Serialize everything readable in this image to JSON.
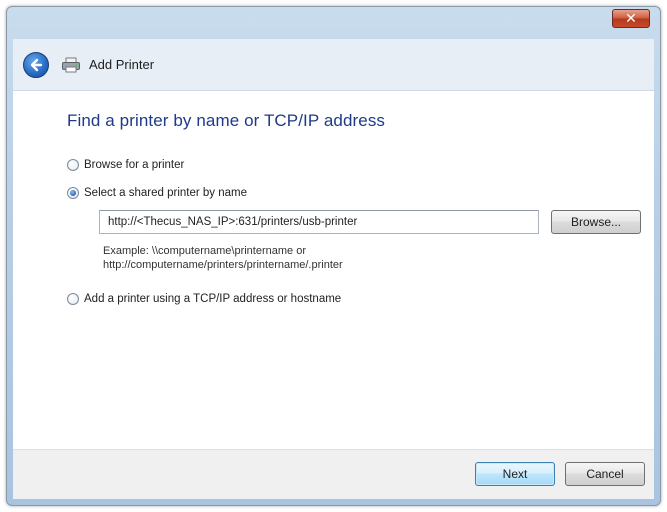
{
  "window": {
    "close_icon": "close-icon",
    "close_glyph": "✕"
  },
  "header": {
    "back_icon": "back-arrow-icon",
    "printer_icon": "printer-icon",
    "title": "Add Printer"
  },
  "main": {
    "heading": "Find a printer by name or TCP/IP address",
    "options": [
      {
        "label": "Browse for a printer",
        "checked": false
      },
      {
        "label": "Select a shared printer by name",
        "checked": true
      },
      {
        "label": "Add a printer using a TCP/IP address or hostname",
        "checked": false
      }
    ],
    "shared_printer": {
      "value": "http://<Thecus_NAS_IP>:631/printers/usb-printer",
      "browse_label": "Browse...",
      "example_line1": "Example: \\\\computername\\printername or",
      "example_line2": "http://computername/printers/printername/.printer"
    }
  },
  "footer": {
    "next_label": "Next",
    "cancel_label": "Cancel"
  },
  "colors": {
    "heading": "#1e3a8a",
    "accent": "#2a6ec8",
    "close": "#c84a2c"
  }
}
